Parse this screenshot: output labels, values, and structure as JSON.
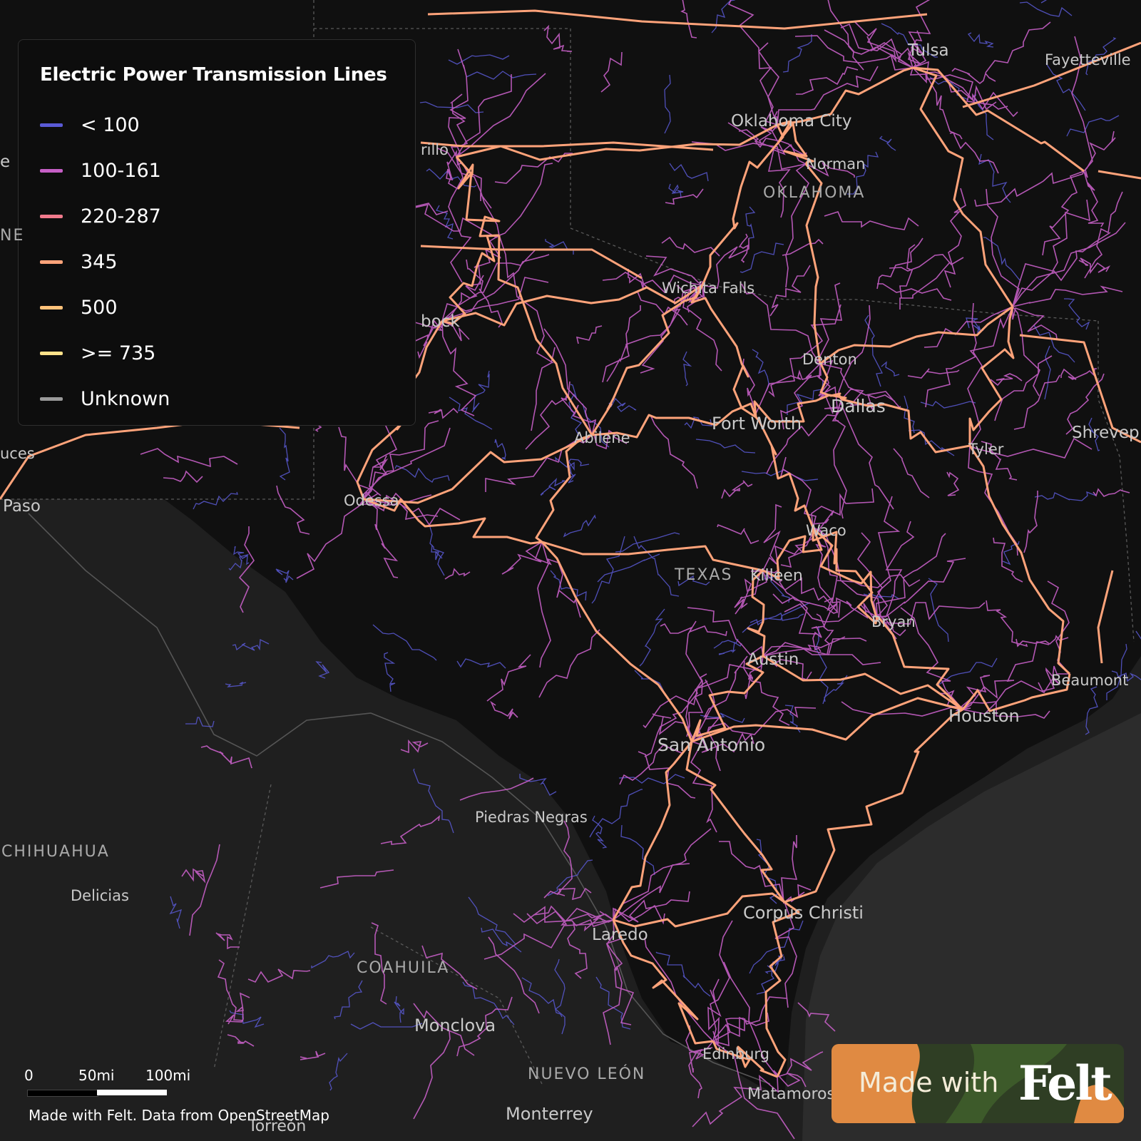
{
  "legend": {
    "title": "Electric Power Transmission Lines",
    "items": [
      {
        "label": "< 100",
        "color": "#5a5ad6"
      },
      {
        "label": "100-161",
        "color": "#c65fc6"
      },
      {
        "label": "220-287",
        "color": "#f07a8c"
      },
      {
        "label": "345",
        "color": "#ffa37a"
      },
      {
        "label": "500",
        "color": "#ffc27a"
      },
      {
        "label": ">= 735",
        "color": "#ffe28a"
      },
      {
        "label": "Unknown",
        "color": "#9a9a9a"
      }
    ]
  },
  "scale": {
    "zero": "0",
    "mid": "50mi",
    "end": "100mi"
  },
  "attribution": "Made with Felt. Data from OpenStreetMap",
  "badge": {
    "text": "Made with",
    "logo": "Felt"
  },
  "places": {
    "tulsa": "Tulsa",
    "fayetteville": "Fayetteville",
    "oklahoma_city": "Oklahoma City",
    "norman": "Norman",
    "oklahoma": "OKLAHOMA",
    "wichita_falls": "Wichita Falls",
    "lubbock": "bock",
    "amarillo": "rillo",
    "denton": "Denton",
    "dallas": "Dallas",
    "fort_worth": "Fort Worth",
    "shreveport": "Shrevep",
    "abilene": "Abilene",
    "tyler": "Tyler",
    "odessa": "Odessa",
    "el_paso": "Paso",
    "las_cruces": "uces",
    "nm_partial": "NE",
    "santa_fe": "e",
    "waco": "Waco",
    "texas": "TEXAS",
    "killeen": "Killeen",
    "bryan": "Bryan",
    "austin": "Austin",
    "beaumont": "Beaumont",
    "houston": "Houston",
    "san_antonio": "San Antonio",
    "piedras_negras": "Piedras Negras",
    "chihuahua": "CHIHUAHUA",
    "delicias": "Delicias",
    "corpus_christi": "Corpus Christi",
    "laredo": "Laredo",
    "coahuila": "COAHUILA",
    "monclova": "Monclova",
    "edinburg": "Edinburg",
    "nuevo_leon": "NUEVO LEÓN",
    "matamoros": "Matamoros",
    "monterrey": "Monterrey",
    "torreon": "Torreón"
  }
}
